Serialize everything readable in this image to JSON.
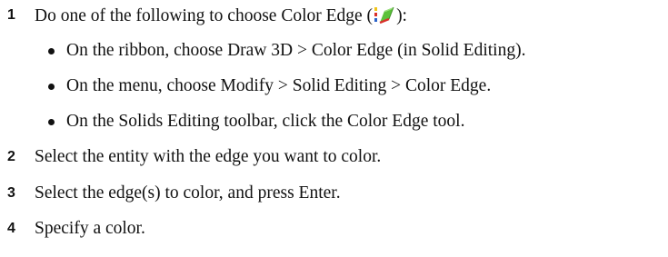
{
  "steps": [
    {
      "number": "1",
      "text_before_icon": "Do one of the following to choose Color Edge (",
      "icon": "color-edge-icon",
      "text_after_icon": "):",
      "bullets": [
        "On the ribbon, choose Draw 3D > Color Edge (in Solid Editing).",
        "On the menu, choose Modify > Solid Editing > Color Edge.",
        "On the Solids Editing toolbar, click the Color Edge tool."
      ]
    },
    {
      "number": "2",
      "text": "Select the entity with the edge you want to color."
    },
    {
      "number": "3",
      "text": "Select the edge(s) to color, and press Enter."
    },
    {
      "number": "4",
      "text": "Specify a color."
    }
  ],
  "colors": {
    "text": "#111111",
    "icon_green": "#5cc13a",
    "icon_red": "#d9302b",
    "icon_blue": "#2b63c9",
    "icon_yellow": "#f0c419"
  }
}
